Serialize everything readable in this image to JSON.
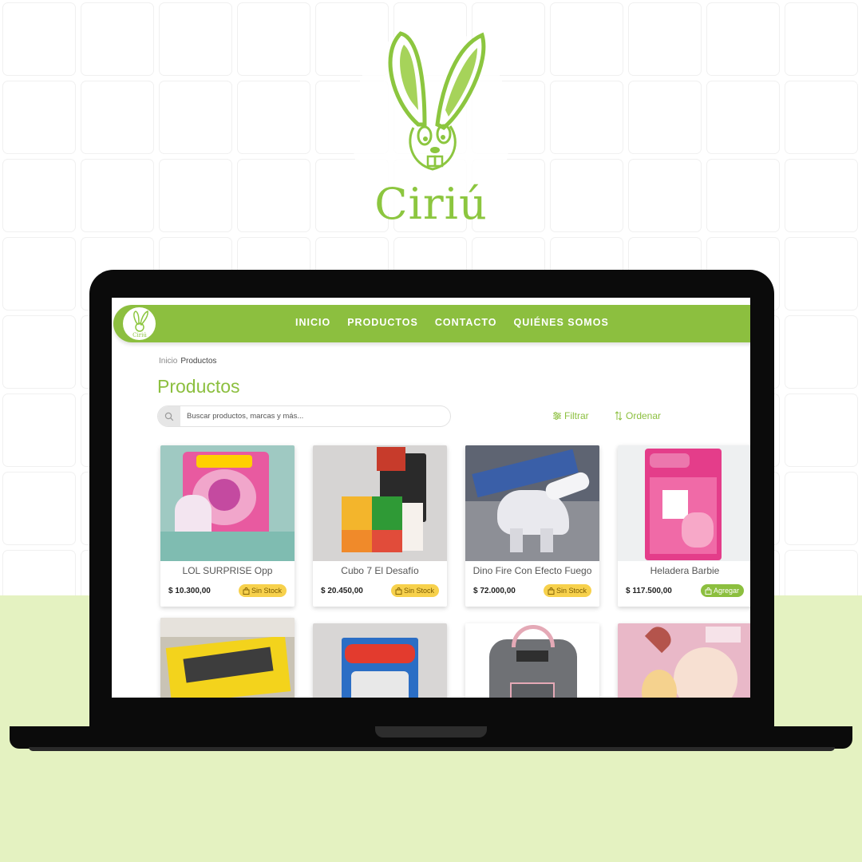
{
  "brand": {
    "name": "Ciriú",
    "colors": {
      "primary": "#8cbf3f",
      "accent_bg": "#e4f2c1",
      "badge_out": "#f7d14c"
    }
  },
  "nav": {
    "logo_icon": "rabbit-logo-icon",
    "links": [
      "INICIO",
      "PRODUCTOS",
      "CONTACTO",
      "QUIÉNES SOMOS"
    ]
  },
  "breadcrumb": {
    "home": "Inicio",
    "current": "Productos"
  },
  "page": {
    "title": "Productos"
  },
  "search": {
    "placeholder": "Buscar productos, marcas y más...",
    "icon": "search-icon"
  },
  "tools": {
    "filter": "Filtrar",
    "sort": "Ordenar"
  },
  "products": [
    {
      "name": "LOL SURPRISE Opp",
      "price": "$ 10.300,00",
      "status": "Sin Stock",
      "available": false
    },
    {
      "name": "Cubo 7 El Desafío",
      "price": "$ 20.450,00",
      "status": "Sin Stock",
      "available": false
    },
    {
      "name": "Dino Fire Con Efecto Fuego",
      "price": "$ 72.000,00",
      "status": "Sin Stock",
      "available": false
    },
    {
      "name": "Heladera Barbie",
      "price": "$ 117.500,00",
      "status": "Agregar",
      "available": true
    }
  ]
}
